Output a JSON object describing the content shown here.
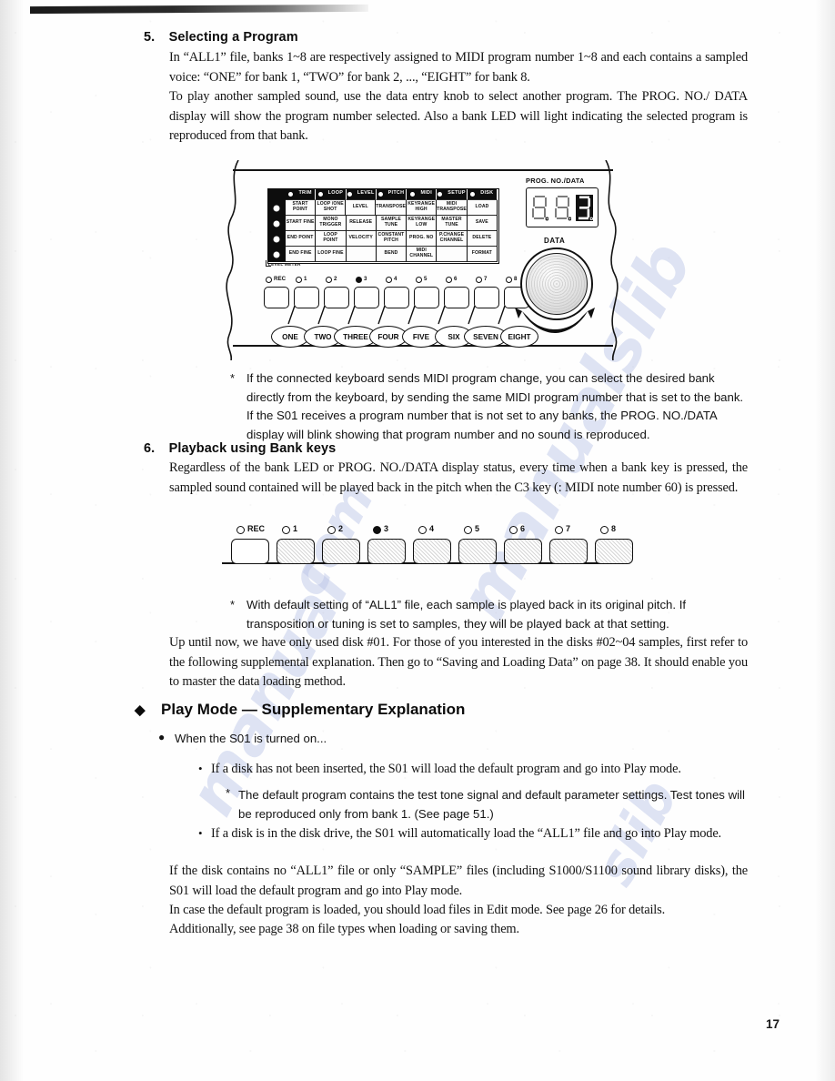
{
  "page": {
    "number": "17"
  },
  "sections": {
    "s5": {
      "num": "5.",
      "title": "Selecting a Program",
      "p1": "In “ALL1” file, banks 1~8 are respectively assigned to MIDI program number 1~8 and each contains a sampled voice: “ONE” for bank 1, “TWO” for bank 2, ..., “EIGHT” for bank 8.",
      "p2": "To play another sampled sound, use the data entry knob to select another program.  The PROG. NO./ DATA display will show the program number selected.  Also a bank LED will light indicating the selected program is reproduced from that bank.",
      "note_marker": "*",
      "note": "If the connected keyboard sends MIDI program change, you can select the desired bank directly from the keyboard, by sending the same MIDI program number that is set to the bank. If the S01 receives a program number that is not set to any banks, the PROG. NO./DATA display will blink showing that program number and no sound is reproduced."
    },
    "s6": {
      "num": "6.",
      "title": "Playback using Bank keys",
      "p1": "Regardless of the bank LED or PROG. NO./DATA display status, every time when a bank key is pressed, the sampled sound contained will be played back in the pitch when the C3 key (: MIDI note number 60) is pressed.",
      "note_marker": "*",
      "note": "With default setting of “ALL1” file, each sample is played back in its original pitch.  If transposition or tuning is set to samples, they will be played back at that setting.",
      "p2": "Up until now, we have only used disk #01.  For those of you interested in the disks #02~04 samples, first refer to the following supplemental explanation.  Then go to “Saving and Loading Data” on page 38.  It should enable you to master the data loading method."
    },
    "play_mode": {
      "diamond": "◆",
      "title": "Play Mode — Supplementary Explanation",
      "bullet_glyph": "●",
      "subtitle": "When the S01 is turned on...",
      "items": [
        {
          "marker": "•",
          "text": "If a disk has not been inserted, the S01 will load the default program and go into Play mode."
        },
        {
          "marker": "*",
          "text": "The default program contains the test tone signal and default parameter settings.  Test tones will be reproduced only from bank 1. (See page 51.)"
        },
        {
          "marker": "•",
          "text": "If a disk is in the disk drive, the S01 will automatically load the “ALL1” file and go into Play mode."
        }
      ],
      "closing1": "If the disk contains no “ALL1” file or only “SAMPLE” files (including S1000/S1100 sound library disks), the S01 will load the default program and go into Play mode.",
      "closing2": "In case the default program is loaded, you should load files in Edit mode.  See page 26 for details.",
      "closing3": "Additionally, see page 38 on file types when loading or saving them."
    }
  },
  "device_panel": {
    "display_label": "PROG. NO./DATA",
    "display_digits": [
      "8",
      "8",
      "3"
    ],
    "data_knob_label": "DATA",
    "level_meter_label": "LEVEL METER",
    "matrix_headers": [
      "TRIM",
      "LOOP",
      "LEVEL",
      "PITCH",
      "MIDI",
      "SETUP",
      "DISK"
    ],
    "matrix_rows": [
      [
        "START POINT",
        "LOOP /ONE SHOT",
        "LEVEL",
        "TRANSPOSE",
        "KEYRANGE HIGH",
        "MIDI TRANSPOSE",
        "LOAD"
      ],
      [
        "START FINE",
        "MONO TRIGGER",
        "RELEASE",
        "SAMPLE TUNE",
        "KEYRANGE LOW",
        "MASTER TUNE",
        "SAVE"
      ],
      [
        "END POINT",
        "LOOP POINT",
        "VELOCITY",
        "CONSTANT PITCH",
        "PROG. NO",
        "P.CHANGE CHANNEL",
        "DELETE"
      ],
      [
        "END FINE",
        "LOOP FINE",
        "",
        "BEND",
        "MIDI CHANNEL",
        "",
        "FORMAT"
      ]
    ],
    "rec_label": "REC",
    "bank_labels": [
      "1",
      "2",
      "3",
      "4",
      "5",
      "6",
      "7",
      "8"
    ],
    "lit_bank": "3",
    "callouts": [
      "ONE",
      "TWO",
      "THREE",
      "FOUR",
      "FIVE",
      "SIX",
      "SEVEN",
      "EIGHT"
    ]
  },
  "device_panel2": {
    "rec_label": "REC",
    "bank_labels": [
      "1",
      "2",
      "3",
      "4",
      "5",
      "6",
      "7",
      "8"
    ],
    "lit_bank": "3"
  },
  "watermark": {
    "w1": "manualslib",
    "w2": "com",
    "w3": "manual",
    "w4": "slib"
  },
  "colors": {
    "ink": "#131313",
    "panel_ink": "#0d0d0d",
    "watermark": "#b9c3e6",
    "paper": "#fefefe"
  }
}
